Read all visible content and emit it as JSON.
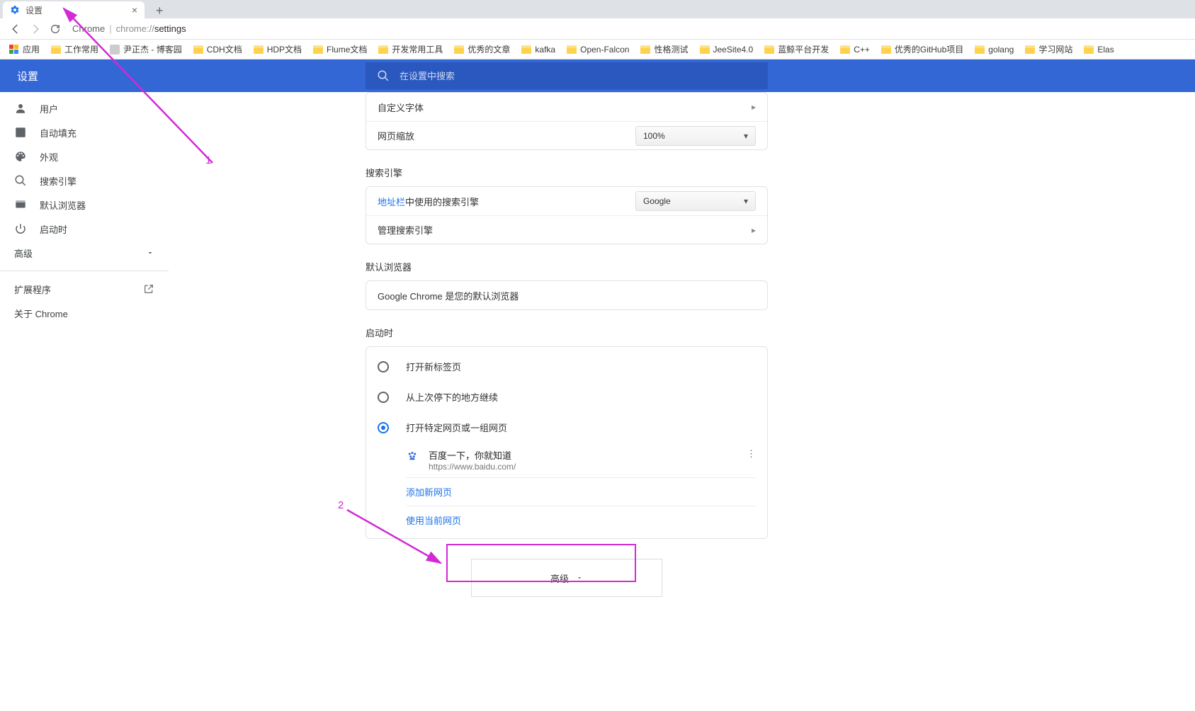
{
  "tab": {
    "title": "设置"
  },
  "addressbar": {
    "prefix": "Chrome",
    "scheme": "chrome://",
    "path": "settings"
  },
  "bookmarks": {
    "apps": "应用",
    "items": [
      {
        "label": "工作常用",
        "kind": "folder"
      },
      {
        "label": "尹正杰 - 博客园",
        "kind": "fav"
      },
      {
        "label": "CDH文档",
        "kind": "folder"
      },
      {
        "label": "HDP文档",
        "kind": "folder"
      },
      {
        "label": "Flume文档",
        "kind": "folder"
      },
      {
        "label": "开发常用工具",
        "kind": "folder"
      },
      {
        "label": "优秀的文章",
        "kind": "folder"
      },
      {
        "label": "kafka",
        "kind": "folder"
      },
      {
        "label": "Open-Falcon",
        "kind": "folder"
      },
      {
        "label": "性格测试",
        "kind": "folder"
      },
      {
        "label": "JeeSite4.0",
        "kind": "folder"
      },
      {
        "label": "蓝鲸平台开发",
        "kind": "folder"
      },
      {
        "label": "C++",
        "kind": "folder"
      },
      {
        "label": "优秀的GitHub项目",
        "kind": "folder"
      },
      {
        "label": "golang",
        "kind": "folder"
      },
      {
        "label": "学习网站",
        "kind": "folder"
      },
      {
        "label": "Elas",
        "kind": "folder"
      }
    ]
  },
  "header": {
    "title": "设置",
    "search_placeholder": "在设置中搜索"
  },
  "sidebar": {
    "items": [
      {
        "label": "用户"
      },
      {
        "label": "自动填充"
      },
      {
        "label": "外观"
      },
      {
        "label": "搜索引擎"
      },
      {
        "label": "默认浏览器"
      },
      {
        "label": "启动时"
      }
    ],
    "advanced": "高级",
    "extensions": "扩展程序",
    "about": "关于 Chrome"
  },
  "content": {
    "font_row": "自定义字体",
    "zoom_row": "网页缩放",
    "zoom_value": "100%",
    "search_section": "搜索引擎",
    "search_addrbar_link": "地址栏",
    "search_addrbar_rest": "中使用的搜索引擎",
    "search_value": "Google",
    "manage_search": "管理搜索引擎",
    "default_browser_section": "默认浏览器",
    "default_browser_text": "Google Chrome 是您的默认浏览器",
    "startup_section": "启动时",
    "startup_options": [
      "打开新标签页",
      "从上次停下的地方继续",
      "打开特定网页或一组网页"
    ],
    "startup_page": {
      "title": "百度一下，你就知道",
      "url": "https://www.baidu.com/"
    },
    "add_new_page": "添加新网页",
    "use_current_pages": "使用当前网页",
    "advanced_button": "高级"
  },
  "annotations": {
    "n1": "1",
    "n2": "2"
  }
}
